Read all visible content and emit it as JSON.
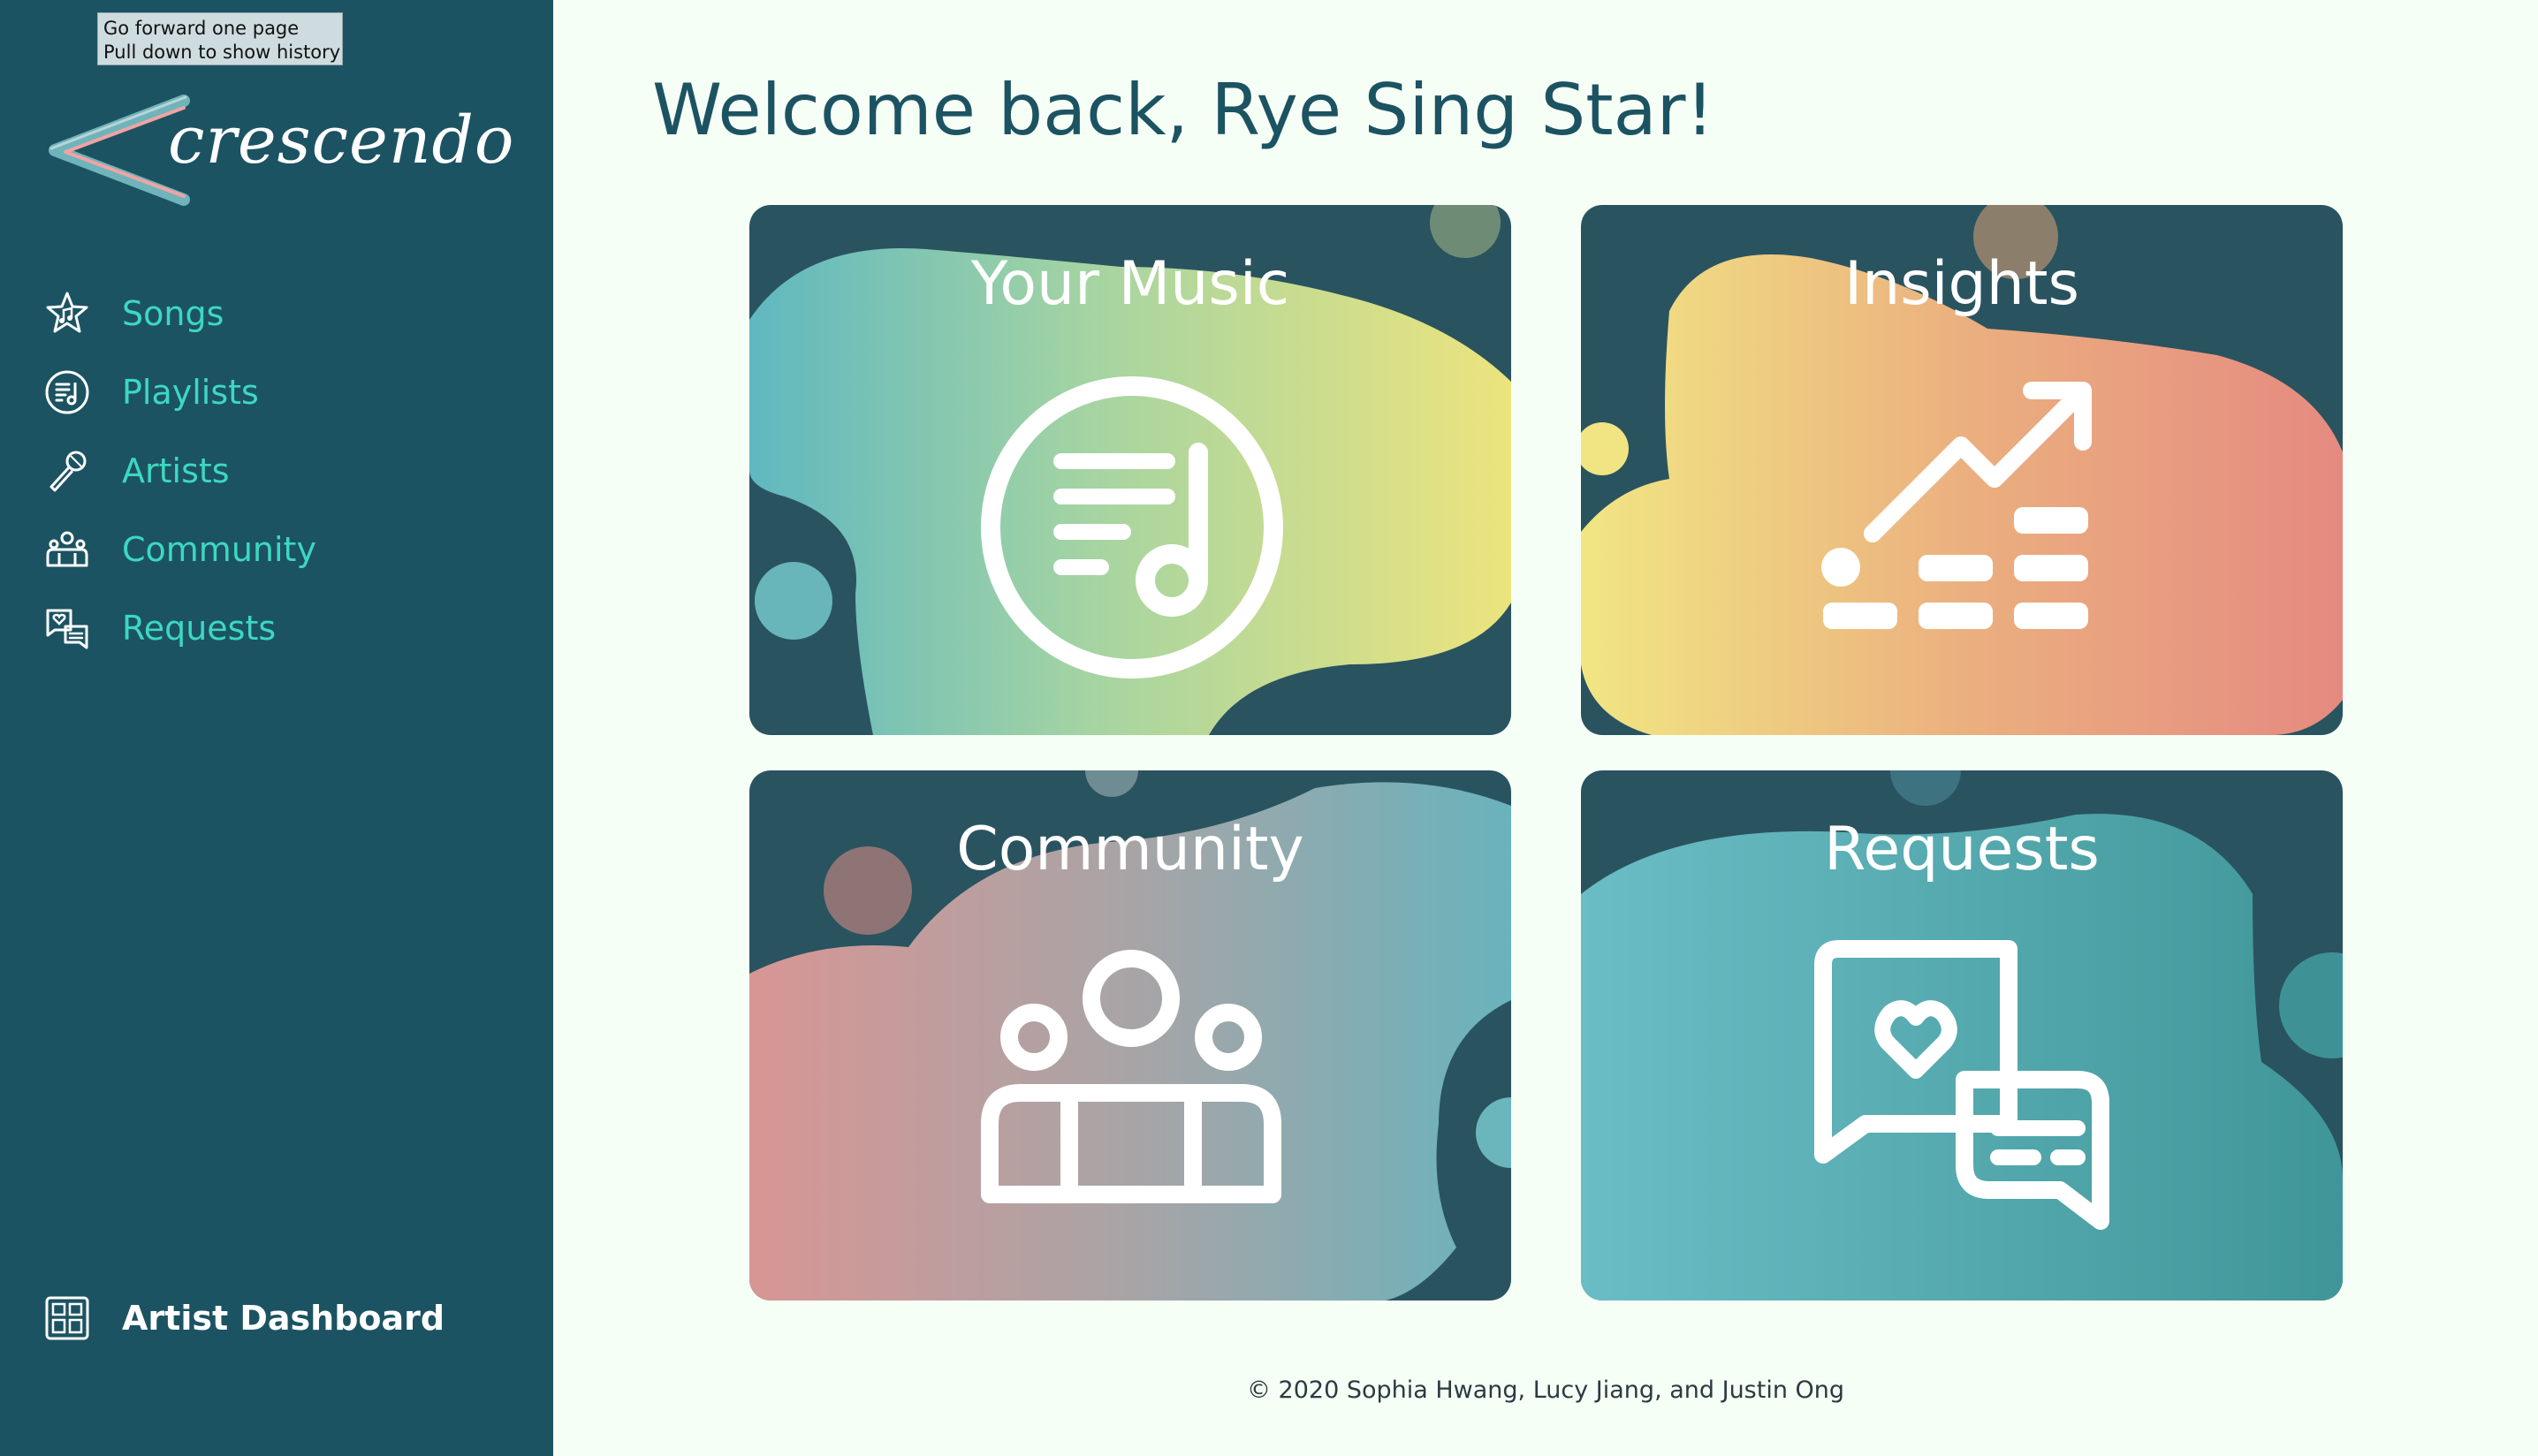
{
  "tooltip": {
    "line1": "Go forward one page",
    "line2": "Pull down to show history"
  },
  "logo": {
    "text": "crescendo"
  },
  "sidebar": {
    "items": [
      {
        "label": "Songs",
        "icon": "star-music-icon"
      },
      {
        "label": "Playlists",
        "icon": "playlist-icon"
      },
      {
        "label": "Artists",
        "icon": "microphone-icon"
      },
      {
        "label": "Community",
        "icon": "people-icon"
      },
      {
        "label": "Requests",
        "icon": "chat-heart-icon"
      }
    ],
    "dashboard": {
      "label": "Artist Dashboard",
      "icon": "dashboard-icon"
    }
  },
  "main": {
    "title": "Welcome back, Rye Sing Star!",
    "cards": [
      {
        "title": "Your Music",
        "icon": "playlist-icon"
      },
      {
        "title": "Insights",
        "icon": "trend-chart-icon"
      },
      {
        "title": "Community",
        "icon": "people-icon"
      },
      {
        "title": "Requests",
        "icon": "chat-heart-icon"
      }
    ]
  },
  "footer": {
    "text": "© 2020 Sophia Hwang, Lucy Jiang, and Justin Ong"
  },
  "colors": {
    "sidebar_bg": "#1c5362",
    "nav_text": "#3dd8c1",
    "card_bg": "#2a5360",
    "page_bg": "#f6fff6"
  }
}
